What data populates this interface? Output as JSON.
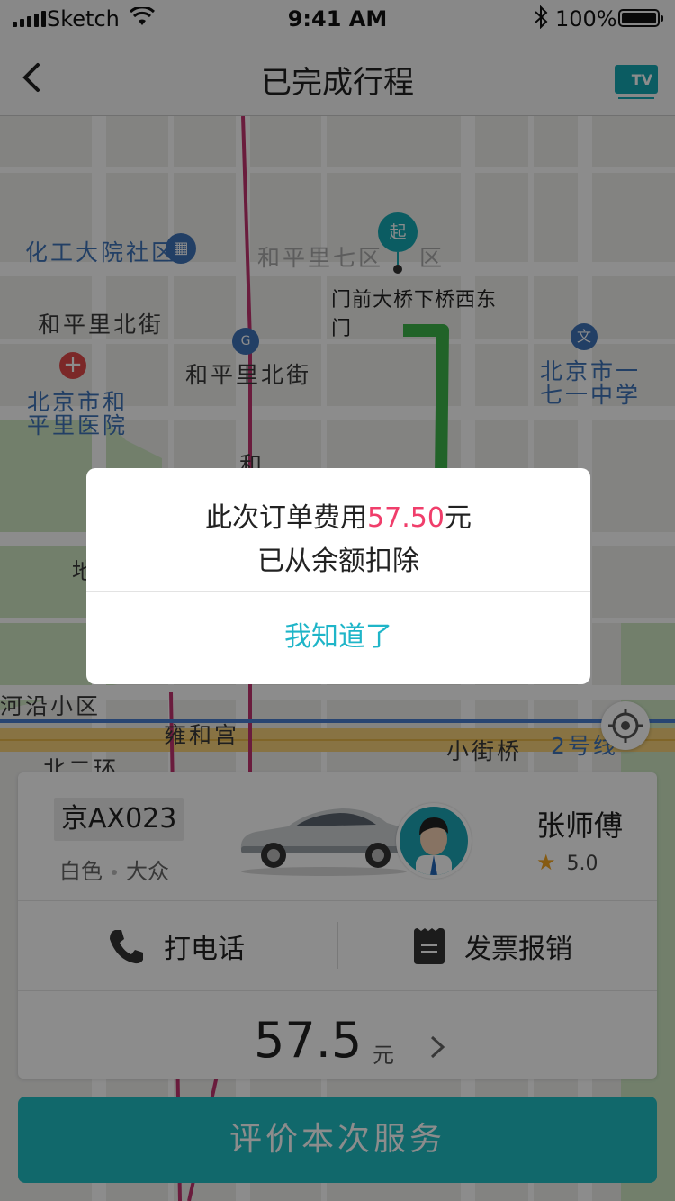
{
  "status_bar": {
    "carrier": "Sketch",
    "time": "9:41 AM",
    "battery": "100%"
  },
  "nav": {
    "title": "已完成行程",
    "tv_label": "TV"
  },
  "map": {
    "labels": {
      "huagong": "化工大院社区",
      "hepingli7": "和平里七区",
      "qu": "区",
      "hepingli_bei1": "和平里北街",
      "hepingli_bei2": "和平里北街",
      "hospital_line1": "北京市和",
      "hospital_line2": "平里医院",
      "school_line1": "北京市一",
      "school_line2": "七一中学",
      "he": "和",
      "di": "地",
      "heyan": "河沿小区",
      "yonghegong": "雍和宫",
      "xiaojieqiao": "小街桥",
      "line2": "2号线",
      "beierhuan": "北二环"
    },
    "start_pin": "起",
    "start_address_line1": "门前大桥下桥西东",
    "start_address_line2": "门"
  },
  "driver_card": {
    "plate": "京AX023",
    "car_color": "白色",
    "car_brand": "大众",
    "driver_name": "张师傅",
    "rating": "5.0",
    "call_label": "打电话",
    "invoice_label": "发票报销",
    "fare": "57.5",
    "fare_unit": "元"
  },
  "rate_button": "评价本次服务",
  "dialog": {
    "line1_prefix": "此次订单费用",
    "amount": "57.50",
    "line1_suffix": "元",
    "line2": "已从余额扣除",
    "confirm": "我知道了"
  },
  "colors": {
    "accent": "#1fbdc4",
    "amount": "#f03e6b",
    "route": "#3cb54a",
    "metro": "#c2336f"
  }
}
